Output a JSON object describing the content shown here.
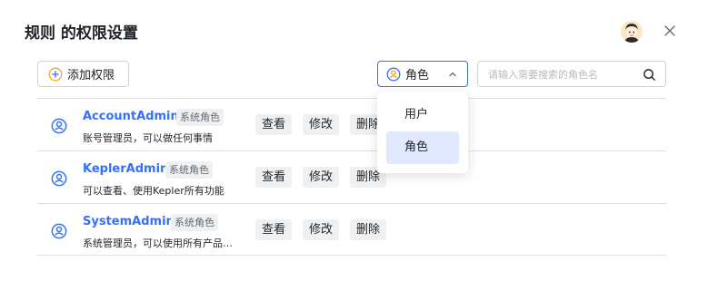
{
  "dialog": {
    "title": "规则 的权限设置"
  },
  "toolbar": {
    "add_label": "添加权限",
    "select_value": "角色",
    "search_placeholder": "请输入需要搜索的角色名"
  },
  "dropdown": {
    "options": [
      {
        "label": "用户",
        "selected": false
      },
      {
        "label": "角色",
        "selected": true
      }
    ]
  },
  "roles": [
    {
      "name": "AccountAdmin",
      "tag": "系统角色",
      "desc": "账号管理员，可以做任何事情"
    },
    {
      "name": "KeplerAdmin",
      "tag": "系统角色",
      "desc": "可以查看、使用Kepler所有功能"
    },
    {
      "name": "SystemAdmin",
      "tag": "系统角色",
      "desc": "系统管理员，可以使用所有产品…"
    }
  ],
  "actions": {
    "view": "查看",
    "edit": "修改",
    "delete": "删除"
  },
  "colors": {
    "accent": "#3370ff",
    "tag_bg": "#eff0f1",
    "selected_bg": "#e0e9ff"
  }
}
